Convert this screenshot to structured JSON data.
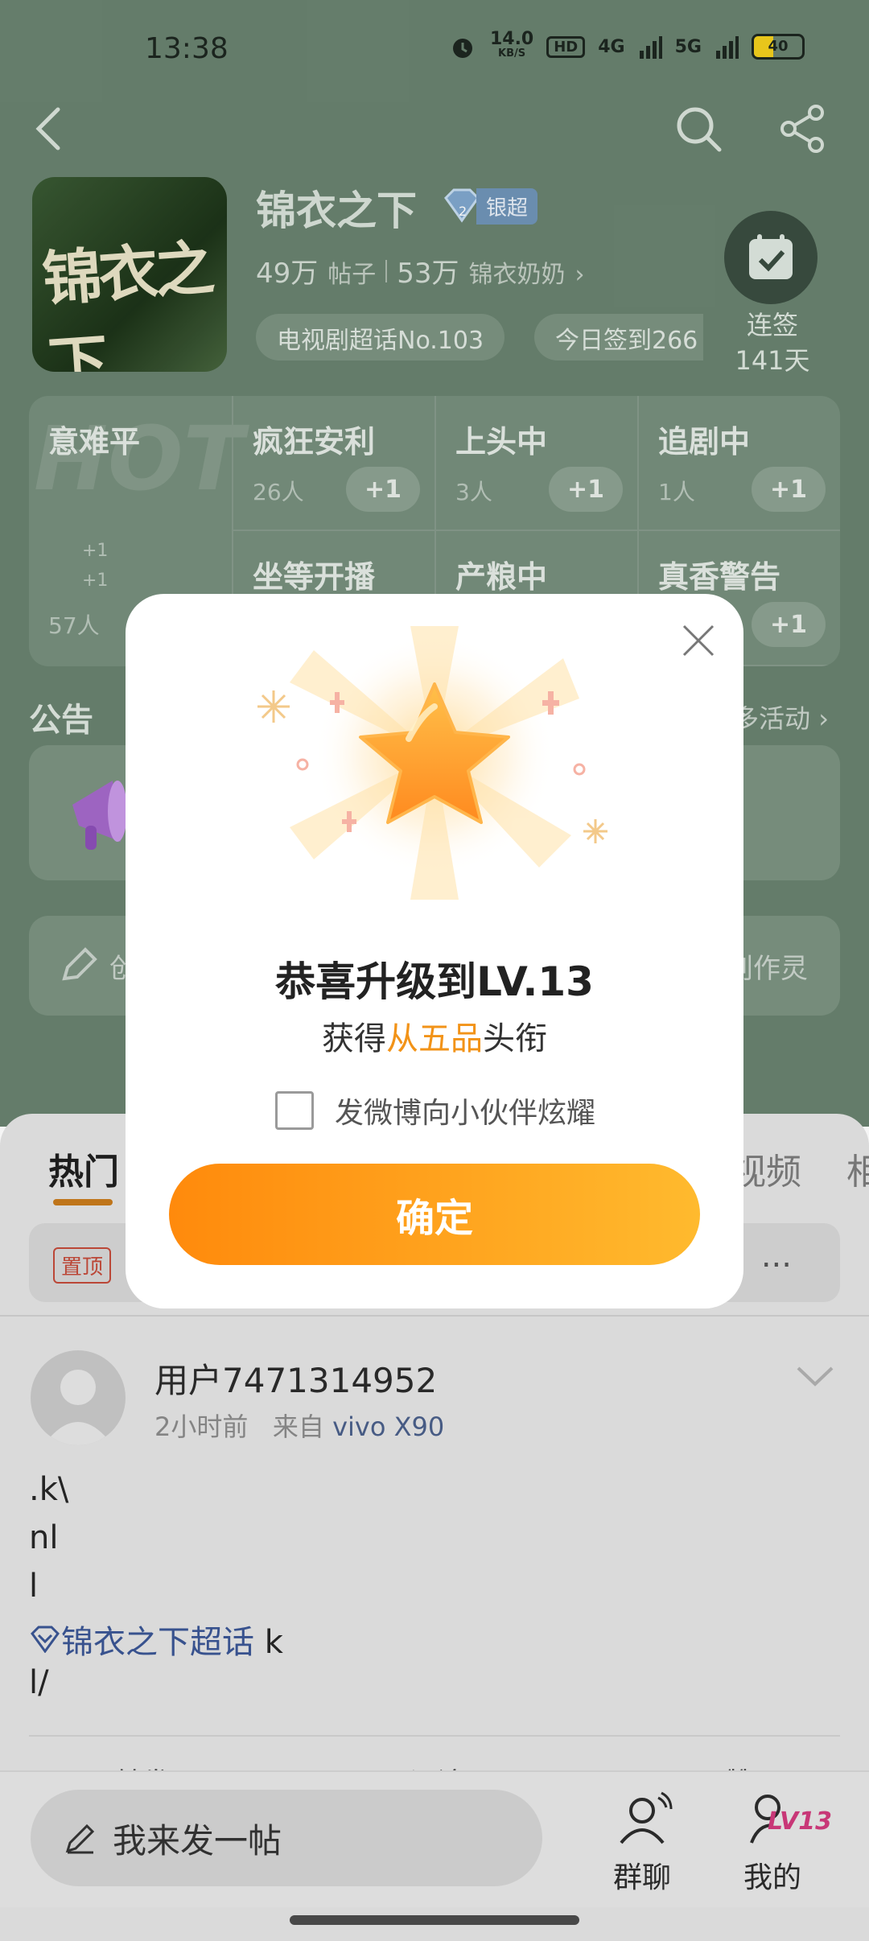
{
  "status_bar": {
    "time": "13:38",
    "net_speed": "14.0",
    "net_unit": "KB/S",
    "hd_label": "HD",
    "sim1": "4G",
    "sim2": "5G",
    "battery": "40",
    "battery_level": 0.4
  },
  "topic": {
    "cover_text": "锦衣之下",
    "title": "锦衣之下",
    "badge": "银超",
    "posts_count": "49万",
    "posts_label": "帖子",
    "fans_count": "53万",
    "fans_label": "锦衣奶奶",
    "rank_chip": "电视剧超话No.103",
    "checkin_chip": "今日签到266",
    "checkin_label": "连签",
    "checkin_days": "141天"
  },
  "tags": {
    "first": {
      "name": "意难平",
      "count": "57人",
      "watermark": "HOT",
      "mini1": "+1",
      "mini2": "+1"
    },
    "items": [
      {
        "name": "疯狂安利",
        "count": "26人",
        "plus": "+1"
      },
      {
        "name": "上头中",
        "count": "3人",
        "plus": "+1"
      },
      {
        "name": "追剧中",
        "count": "1人",
        "plus": "+1"
      },
      {
        "name": "坐等开播",
        "count": "",
        "plus": ""
      },
      {
        "name": "产粮中",
        "count": "",
        "plus": ""
      },
      {
        "name": "真香警告",
        "count": "",
        "plus": "+1"
      }
    ]
  },
  "notice": {
    "title": "公告",
    "more": "多活动",
    "create_left": "创",
    "create_right": "的创作灵"
  },
  "feed": {
    "tabs": [
      {
        "label": "热门"
      },
      {
        "label": "视频"
      },
      {
        "label": "相"
      }
    ],
    "pinned_tag": "置顶",
    "pinned_more": "...",
    "post": {
      "username": "用户7471314952",
      "time": "2小时前",
      "from_label": "来自",
      "device": "vivo X90",
      "lines": [
        ".k\\",
        "nl",
        "l"
      ],
      "topic_link": "锦衣之下超话",
      "topic_suffix": " k",
      "last_line": "l/"
    },
    "actions": {
      "repost": "转发",
      "comment": "评论",
      "like": "赞"
    }
  },
  "bottom_bar": {
    "compose": "我来发一帖",
    "group_chat": "群聊",
    "mine": "我的",
    "level_badge": "LV13"
  },
  "dialog": {
    "title": "恭喜升级到LV.13",
    "subtitle_prefix": "获得",
    "subtitle_highlight": "从五品",
    "subtitle_suffix": "头衔",
    "share_checkbox": "发微博向小伙伴炫耀",
    "confirm": "确定"
  }
}
